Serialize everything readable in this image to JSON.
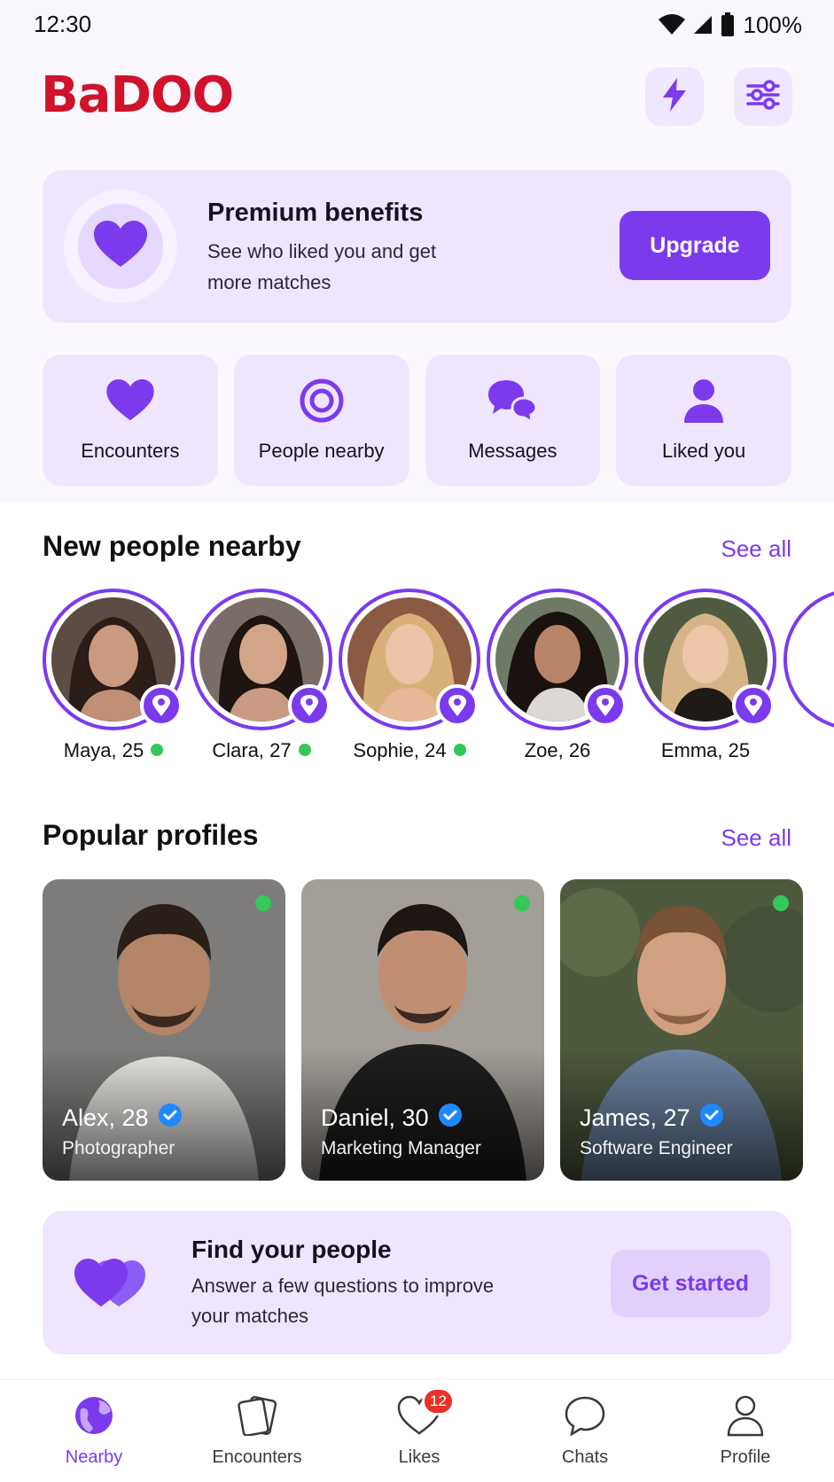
{
  "status_bar": {
    "time": "12:30",
    "battery": "100%"
  },
  "header": {
    "logo": "BaDOO",
    "boost_icon": "lightning-icon",
    "filter_icon": "sliders-icon"
  },
  "premium": {
    "title": "Premium benefits",
    "subtitle": "See who liked you and get more matches",
    "button": "Upgrade",
    "icon": "heart-icon"
  },
  "quick_actions": [
    {
      "label": "Encounters",
      "icon": "heart-icon"
    },
    {
      "label": "People nearby",
      "icon": "target-icon"
    },
    {
      "label": "Messages",
      "icon": "chat-bubbles-icon"
    },
    {
      "label": "Liked you",
      "icon": "person-icon"
    }
  ],
  "nearby": {
    "title": "New people nearby",
    "see_all": "See all",
    "people": [
      {
        "name": "Maya, 25",
        "online": true
      },
      {
        "name": "Clara, 27",
        "online": true
      },
      {
        "name": "Sophie, 24",
        "online": true
      },
      {
        "name": "Zoe, 26",
        "online": false
      },
      {
        "name": "Emma, 25",
        "online": false
      }
    ]
  },
  "popular": {
    "title": "Popular profiles",
    "see_all": "See all",
    "profiles": [
      {
        "name": "Alex, 28",
        "role": "Photographer",
        "verified": true,
        "online": true
      },
      {
        "name": "Daniel, 30",
        "role": "Marketing Manager",
        "verified": true,
        "online": true
      },
      {
        "name": "James, 27",
        "role": "Software Engineer",
        "verified": true,
        "online": true
      }
    ]
  },
  "find_people": {
    "title": "Find your people",
    "subtitle": "Answer a few questions to improve your matches",
    "button": "Get started",
    "icon": "double-heart-icon"
  },
  "bottom_nav": [
    {
      "label": "Nearby",
      "icon": "globe-icon",
      "active": true
    },
    {
      "label": "Encounters",
      "icon": "cards-icon",
      "active": false
    },
    {
      "label": "Likes",
      "icon": "heart-outline-icon",
      "active": false,
      "badge": "12"
    },
    {
      "label": "Chats",
      "icon": "chat-icon",
      "active": false
    },
    {
      "label": "Profile",
      "icon": "user-icon",
      "active": false
    }
  ],
  "colors": {
    "accent": "#7c3aed",
    "brand": "#d0122b",
    "online": "#34c759",
    "badge": "#e5322d",
    "card_bg": "#efe5ff"
  }
}
